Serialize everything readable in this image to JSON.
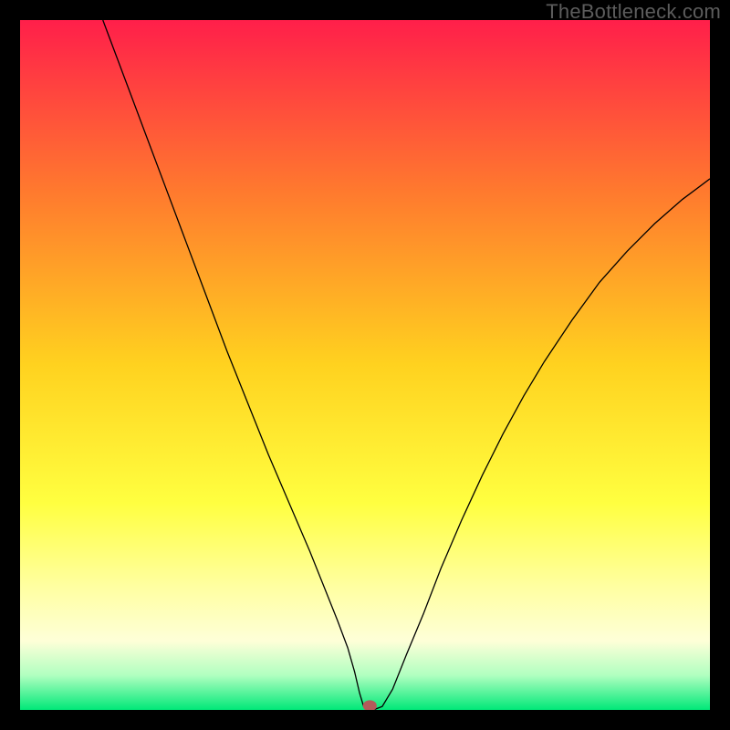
{
  "watermark": "TheBottleneck.com",
  "chart_data": {
    "type": "line",
    "title": "",
    "xlabel": "",
    "ylabel": "",
    "xlim": [
      0,
      100
    ],
    "ylim": [
      0,
      100
    ],
    "background_gradient": {
      "stops": [
        {
          "offset": 0.0,
          "color": "#ff1f4a"
        },
        {
          "offset": 0.25,
          "color": "#ff7a2e"
        },
        {
          "offset": 0.5,
          "color": "#ffd21f"
        },
        {
          "offset": 0.7,
          "color": "#ffff40"
        },
        {
          "offset": 0.82,
          "color": "#ffffa0"
        },
        {
          "offset": 0.9,
          "color": "#feffd8"
        },
        {
          "offset": 0.95,
          "color": "#b0ffc0"
        },
        {
          "offset": 1.0,
          "color": "#00e878"
        }
      ]
    },
    "curve": {
      "x": [
        12.0,
        15.0,
        18.0,
        21.0,
        24.0,
        27.0,
        30.0,
        33.0,
        36.0,
        39.0,
        42.0,
        44.0,
        46.0,
        47.5,
        48.5,
        49.2,
        49.8,
        50.3,
        51.2,
        52.5,
        54.0,
        56.0,
        58.5,
        61.0,
        64.0,
        67.0,
        70.0,
        73.0,
        76.0,
        80.0,
        84.0,
        88.0,
        92.0,
        96.0,
        100.0
      ],
      "y": [
        100.0,
        92.0,
        84.0,
        76.0,
        68.0,
        60.0,
        52.0,
        44.5,
        37.0,
        30.0,
        23.0,
        18.0,
        13.0,
        9.0,
        5.5,
        2.5,
        0.5,
        0.0,
        0.0,
        0.5,
        3.0,
        8.0,
        14.0,
        20.5,
        27.5,
        34.0,
        40.0,
        45.5,
        50.5,
        56.5,
        62.0,
        66.5,
        70.5,
        74.0,
        77.0
      ]
    },
    "minimum_marker": {
      "x": 50.7,
      "y": 0.0,
      "rx": 1.0,
      "ry": 0.8,
      "color": "#b35a5a"
    }
  }
}
